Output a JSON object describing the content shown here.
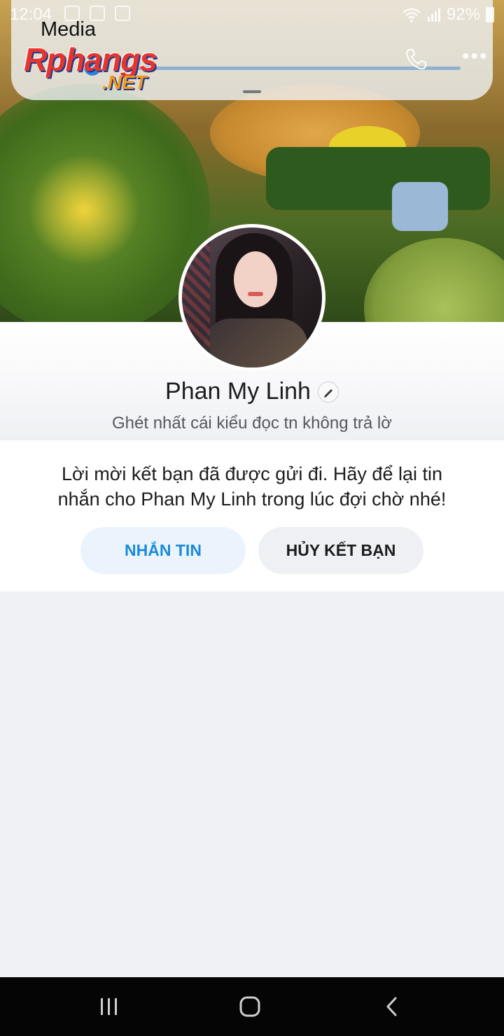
{
  "status_bar": {
    "time": "12:04",
    "battery": "92%",
    "icons": [
      "wifi-icon",
      "signal-icon",
      "battery-icon"
    ]
  },
  "watermark": {
    "top_text": "Media",
    "logo_text": "Rphangs",
    "suffix": ".NET"
  },
  "profile": {
    "name": "Phan My Linh",
    "status": "Ghét nhất cái kiểu đọc tn không trả lờ"
  },
  "friend_request": {
    "message": "Lời mời kết bạn đã được gửi đi. Hãy để lại tin nhắn cho Phan My Linh trong lúc đợi chờ nhé!",
    "message_button": "NHẮN TIN",
    "unfriend_button": "HỦY KẾT BẠN"
  },
  "colors": {
    "accent_blue": "#1a8ad9",
    "button_light_blue": "#ebf4fc",
    "button_gray": "#eef0f3",
    "page_background": "#f0f1f5",
    "nav_bar": "#050505"
  }
}
